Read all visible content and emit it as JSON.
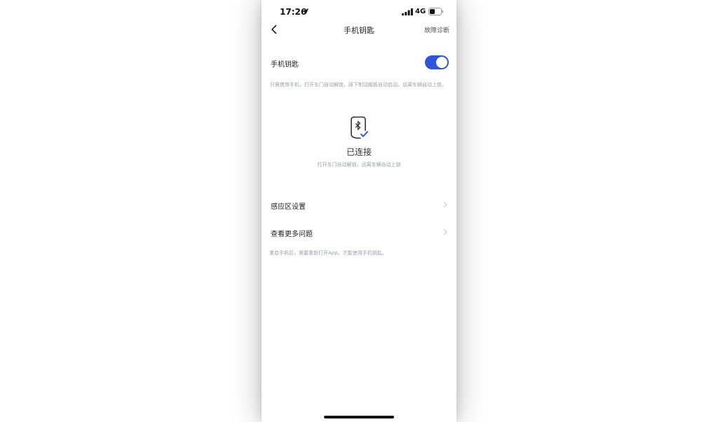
{
  "status_bar": {
    "time": "17:26",
    "network": "4G",
    "icons": [
      "location-arrow-icon",
      "signal-bars-icon",
      "battery-icon"
    ]
  },
  "nav": {
    "title": "手机钥匙",
    "action": "故障诊断",
    "back_icon": "chevron-left-icon"
  },
  "phone_key": {
    "label": "手机钥匙",
    "enabled": true,
    "description": "只需携带手机，打开车门自动解锁，踩下制动踏板自动启动，远离车辆自动上锁。"
  },
  "connection": {
    "status": "已连接",
    "description": "打开车门自动解锁，远离车辆自动上锁",
    "icon": "bluetooth-key-check-icon"
  },
  "menu": {
    "items": [
      {
        "label": "感应区设置"
      },
      {
        "label": "查看更多问题"
      }
    ]
  },
  "footnote": "重启手机后，需要重新打开App，才能使用手机钥匙。",
  "colors": {
    "accent": "#2e55dc",
    "text_primary": "#222222",
    "text_secondary": "#9aa0a6"
  }
}
